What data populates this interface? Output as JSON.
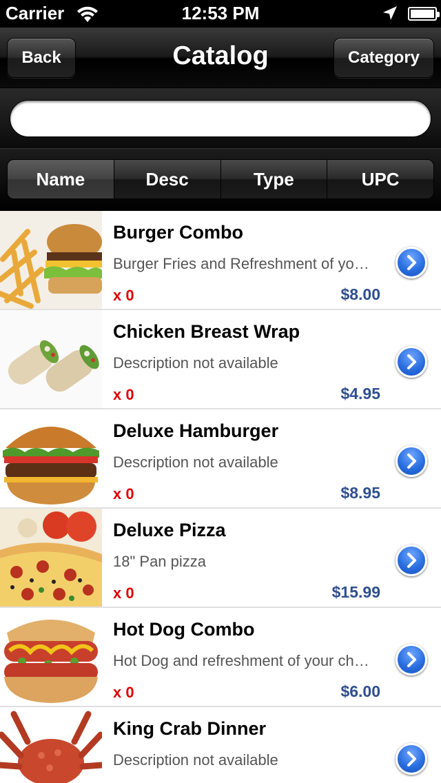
{
  "status_bar": {
    "carrier": "Carrier",
    "time": "12:53 PM"
  },
  "nav": {
    "back_label": "Back",
    "title": "Catalog",
    "category_label": "Category"
  },
  "search": {
    "value": "",
    "placeholder": ""
  },
  "segments": [
    {
      "label": "Name",
      "selected": true
    },
    {
      "label": "Desc",
      "selected": false
    },
    {
      "label": "Type",
      "selected": false
    },
    {
      "label": "UPC",
      "selected": false
    }
  ],
  "items": [
    {
      "name": "Burger Combo",
      "description": "Burger Fries and Refreshment of your choice",
      "qty": "x 0",
      "price": "$8.00",
      "image": "burger-combo"
    },
    {
      "name": "Chicken Breast Wrap",
      "description": "Description not available",
      "qty": "x 0",
      "price": "$4.95",
      "image": "chicken-wrap"
    },
    {
      "name": "Deluxe Hamburger",
      "description": "Description not available",
      "qty": "x 0",
      "price": "$8.95",
      "image": "deluxe-hamburger"
    },
    {
      "name": "Deluxe Pizza",
      "description": "18\" Pan pizza",
      "qty": "x 0",
      "price": "$15.99",
      "image": "deluxe-pizza"
    },
    {
      "name": "Hot Dog Combo",
      "description": "Hot Dog and refreshment of your choice",
      "qty": "x 0",
      "price": "$6.00",
      "image": "hot-dog-combo"
    },
    {
      "name": "King Crab Dinner",
      "description": "Description not available",
      "qty": "",
      "price": "",
      "image": "king-crab"
    }
  ],
  "colors": {
    "qty": "#e00000",
    "price": "#2f4f8f",
    "disclosure": "#2a6fe0",
    "chrome": "#1a1a1a"
  }
}
